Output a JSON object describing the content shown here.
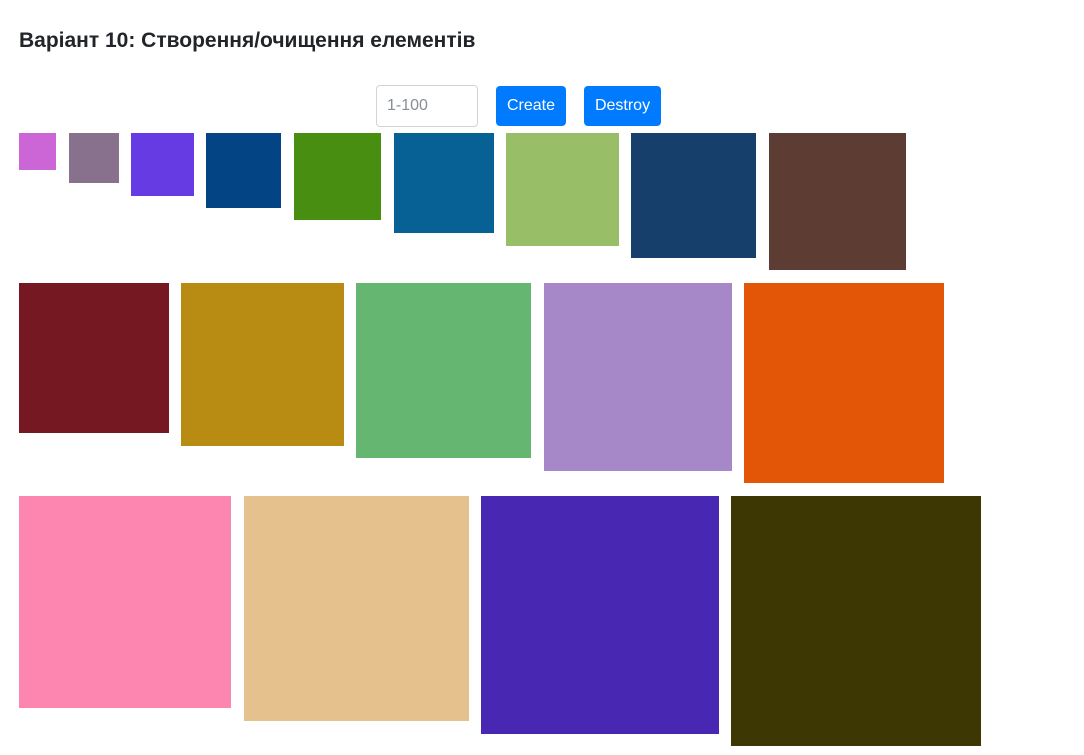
{
  "header": {
    "title": "Варіант 10: Створення/очищення елементів"
  },
  "controls": {
    "input_placeholder": "1-100",
    "input_value": "",
    "create_label": "Create",
    "destroy_label": "Destroy",
    "accent_color": "#007bff"
  },
  "boxes": {
    "count": 18,
    "colors": [
      "#cc66d6",
      "#88718c",
      "#673be4",
      "#034485",
      "#488e10",
      "#076195",
      "#98bf68",
      "#173f6b",
      "#5d3c34",
      "#761821",
      "#b88b12",
      "#64b670",
      "#a687c8",
      "#e35608",
      "#fd86b1",
      "#e5c28d",
      "#4828b2",
      "#3d3703"
    ]
  }
}
